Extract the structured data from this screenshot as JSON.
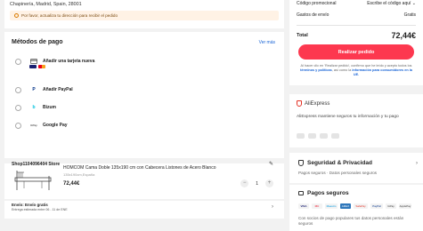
{
  "address": {
    "text": "Chapinería, Madrid, Spain, 28001",
    "warning": "Por favor, actualiza tu dirección para recibir el pedido"
  },
  "payment": {
    "title": "Métodos de pago",
    "more_link": "Ver más",
    "options": [
      {
        "label": "Añadir una tarjeta nueva",
        "icon": "card-icon"
      },
      {
        "label": "Añadir PayPal",
        "icon": "paypal-icon"
      },
      {
        "label": "Bizum",
        "icon": "bizum-icon"
      },
      {
        "label": "Google Pay",
        "icon": "google-pay-icon"
      }
    ],
    "google_pay_badge": "GPay",
    "paypal_badge": "P",
    "bizum_badge": "b"
  },
  "store": {
    "name": "Shop1104096404 Store",
    "product_name": "HOMCOM Cama Doble 135x190 cm con Cabecera Listones de Acero Blanco",
    "variant": "135x190cm,España",
    "price": "72,44€",
    "quantity": "1",
    "minus": "−",
    "plus": "+"
  },
  "shipping": {
    "line1": "Envío: Envío gratis",
    "line2": "Entrega estimada entre 06 - 11 de ENE"
  },
  "summary": {
    "promo_label": "Código promocional",
    "promo_value": "Escribe el código aquí",
    "shipping_label": "Gastos de envío",
    "shipping_value": "Gratis",
    "total_label": "Total",
    "total_value": "72,44€",
    "cta": "Realizar pedido",
    "legal_1": "Al hacer clic en 'Realizar pedido', confirmo que he leído y acepto todos los",
    "legal_link_1": "términos y políticas",
    "legal_2": ", así como la",
    "legal_link_2": "información para consumidores en la UE."
  },
  "aliexpress": {
    "brand": "AliExpress",
    "description": "AliExpress mantiene seguros tu información y tu pago"
  },
  "security": {
    "title": "Seguridad & Privacidad",
    "subtitle": "Pagos seguros · Datos personales seguros"
  },
  "secure_payments": {
    "title": "Pagos seguros",
    "description": "Con socios de pago populares tus datos personales están seguros",
    "logos": [
      "VISA",
      "MC",
      "Maestro",
      "AMEX",
      "SafePay",
      "PayPal",
      "GPay",
      "ApplePay"
    ]
  },
  "colors": {
    "accent": "#fd384f",
    "link": "#1a65d6",
    "warning_bg": "#fff2e5"
  }
}
